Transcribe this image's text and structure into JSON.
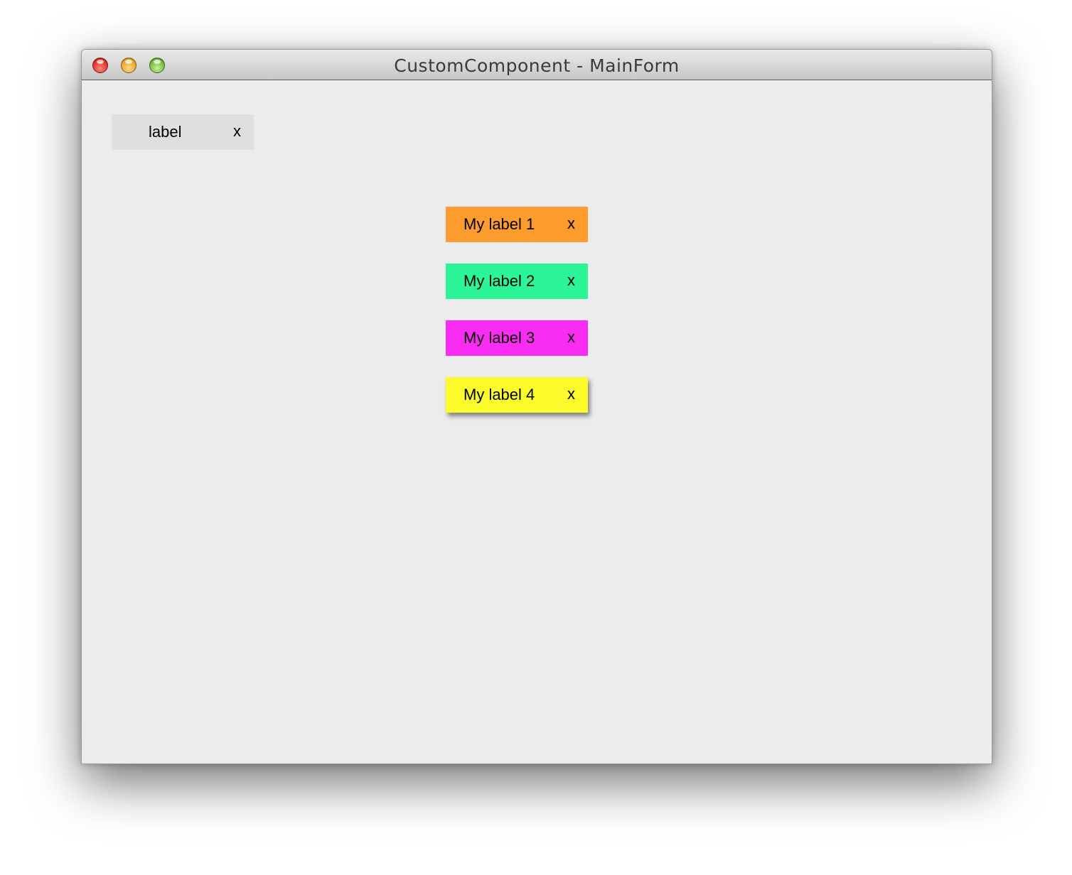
{
  "window": {
    "title": "CustomComponent - MainForm",
    "controls": [
      "close-icon",
      "minimize-icon",
      "zoom-icon"
    ]
  },
  "template_chip": {
    "label": "label",
    "close": "x",
    "color": "#dfdfdf"
  },
  "chips": [
    {
      "label": "My label 1",
      "close": "x",
      "color": "#fc9c2c"
    },
    {
      "label": "My label 2",
      "close": "x",
      "color": "#2cf597"
    },
    {
      "label": "My label 3",
      "close": "x",
      "color": "#f92cf3"
    },
    {
      "label": "My label 4",
      "close": "x",
      "color": "#fbfb2c"
    }
  ]
}
